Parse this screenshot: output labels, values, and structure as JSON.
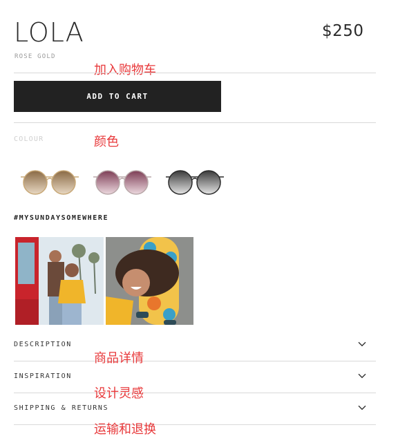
{
  "product": {
    "name": "LOLA",
    "variant": "ROSE GOLD",
    "price": "$250"
  },
  "cart": {
    "add_to_cart_label": "ADD TO CART",
    "annotation": "加入购物车"
  },
  "colour": {
    "label": "COLOUR",
    "annotation": "颜色",
    "swatches": [
      {
        "icon": "gold-round-sunglasses-icon",
        "frame_color": "#c8a877",
        "lens_color": "#a07a4e"
      },
      {
        "icon": "rose-round-sunglasses-icon",
        "frame_color": "#b8a7a8",
        "lens_color": "#8f4d63"
      },
      {
        "icon": "black-round-sunglasses-icon",
        "frame_color": "#2a2a2a",
        "lens_color": "#4a4a4a"
      }
    ]
  },
  "social": {
    "hashtag": "#MYSUNDAYSOMEWHERE",
    "photos": [
      {
        "icon": "couple-street-photo"
      },
      {
        "icon": "woman-skateboard-photo"
      }
    ]
  },
  "accordion": {
    "items": [
      {
        "label": "DESCRIPTION",
        "annotation": "商品详情",
        "icon": "chevron-down-icon"
      },
      {
        "label": "INSPIRATION",
        "annotation": "设计灵感",
        "icon": "chevron-down-icon"
      },
      {
        "label": "SHIPPING & RETURNS",
        "annotation": "运输和退换",
        "icon": "chevron-down-icon"
      }
    ]
  },
  "colors": {
    "annotation": "#e8383a",
    "button_bg": "#222222",
    "divider": "#d9d9d9"
  }
}
